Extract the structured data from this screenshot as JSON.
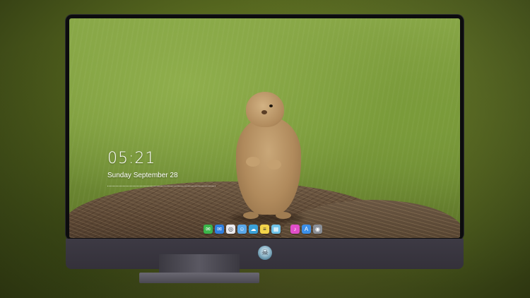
{
  "lock_screen": {
    "time": "05:21",
    "date": "Sunday September  28"
  },
  "dock": {
    "apps": [
      {
        "icon": "messages-icon",
        "glyph": "✉",
        "color": "#3bb54a"
      },
      {
        "icon": "mail-icon",
        "glyph": "✉",
        "color": "#2f7fe0"
      },
      {
        "icon": "safari-compass-icon",
        "glyph": "◎",
        "color": "#e9e9ee"
      },
      {
        "icon": "finder-icon",
        "glyph": "☺",
        "color": "#5aa7e8"
      },
      {
        "icon": "weather-icon",
        "glyph": "☁",
        "color": "#3aa0d8"
      },
      {
        "icon": "notes-icon",
        "glyph": "≡",
        "color": "#f3d34a"
      },
      {
        "icon": "photos-icon",
        "glyph": "▦",
        "color": "#6fc2e8"
      },
      {
        "icon": "itunes-music-icon",
        "glyph": "♪",
        "color": "#e04ec8"
      },
      {
        "icon": "app-store-icon",
        "glyph": "A",
        "color": "#3b8fe8"
      },
      {
        "icon": "camera-icon",
        "glyph": "◉",
        "color": "#8a8f97"
      }
    ]
  },
  "colors": {
    "bezel": "#0c0c0e",
    "chin": "#3d3a44",
    "wall_green": "#56671f"
  }
}
